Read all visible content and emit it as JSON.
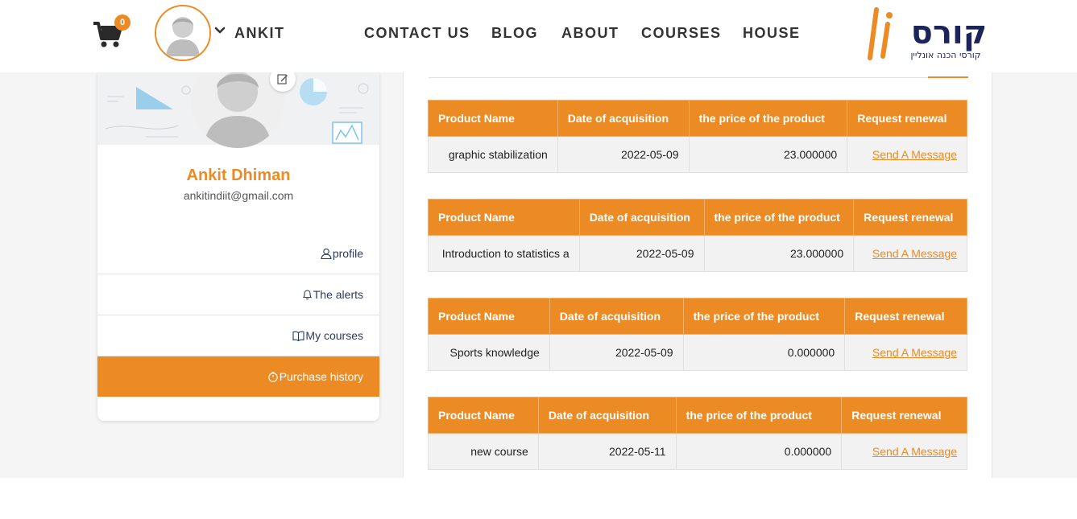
{
  "header": {
    "cart_count": "0",
    "user_name": "ANKIT",
    "nav": [
      "CONTACT US",
      "BLOG",
      "ABOUT",
      "COURSES",
      "HOUSE"
    ],
    "logo_text": "קורס",
    "logo_tagline": "קורסי הכנה אונליין"
  },
  "profile": {
    "full_name": "Ankit Dhiman",
    "email": "ankitindiit@gmail.com",
    "menu": [
      "profile",
      "The alerts",
      "My courses",
      "Purchase history"
    ],
    "active_item": "Purchase history"
  },
  "purchases": {
    "columns": [
      "Product Name",
      "Date of acquisition",
      "the price of the product",
      "Request renewal"
    ],
    "action_label": "Send A Message",
    "rows": [
      {
        "name": "graphic stabilization",
        "date": "2022-05-09",
        "price": "23.000000"
      },
      {
        "name": "Introduction to statistics a",
        "date": "2022-05-09",
        "price": "23.000000"
      },
      {
        "name": "Sports knowledge",
        "date": "2022-05-09",
        "price": "0.000000"
      },
      {
        "name": "new course",
        "date": "2022-05-11",
        "price": "0.000000"
      }
    ]
  },
  "colors": {
    "accent": "#ec8b23",
    "logo_navy": "#1c2559",
    "page_bg": "#f5f5f5"
  }
}
